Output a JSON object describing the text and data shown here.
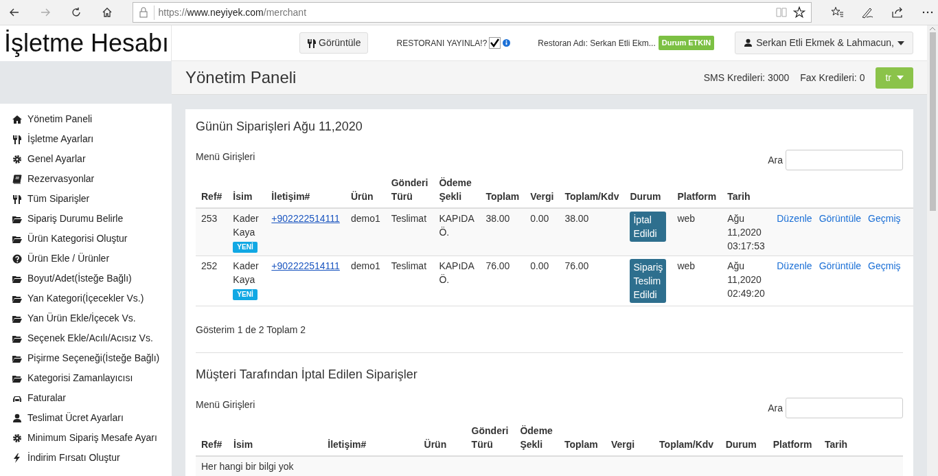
{
  "browser": {
    "url_scheme": "https://",
    "url_host": "www.neyiyek.com",
    "url_path": "/merchant"
  },
  "header": {
    "brand": "İşletme Hesabı",
    "view_button": "Görüntüle",
    "publish_label": "RESTORANI YAYINLA!?",
    "publish_checked": true,
    "restaurant_name": "Restoran Adı: Serkan Etli Ekm...",
    "status_badge": "Durum ETKIN",
    "user_menu": "Serkan Etli Ekmek & Lahmacun,"
  },
  "subheader": {
    "title": "Yönetim Paneli",
    "sms": "SMS Kredileri: 3000",
    "fax": "Fax Kredileri: 0",
    "language": "tr"
  },
  "sidebar": {
    "items": [
      {
        "label": "Yönetim Paneli"
      },
      {
        "label": "İşletme Ayarları"
      },
      {
        "label": "Genel Ayarlar"
      },
      {
        "label": "Rezervasyonlar"
      },
      {
        "label": "Tüm Siparişler"
      },
      {
        "label": "Sipariş Durumu Belirle"
      },
      {
        "label": "Ürün Kategorisi Oluştur"
      },
      {
        "label": "Ürün Ekle / Ürünler"
      },
      {
        "label": "Boyut/Adet(İsteğe Bağlı)"
      },
      {
        "label": "Yan Kategori(İçecekler Vs.)"
      },
      {
        "label": "Yan Ürün Ekle/İçecek Vs."
      },
      {
        "label": "Seçenek Ekle/Acılı/Acısız Vs."
      },
      {
        "label": "Pişirme Seçeneği(İsteğe Bağlı)"
      },
      {
        "label": "Kategorisi Zamanlayıcısı"
      },
      {
        "label": "Faturalar"
      },
      {
        "label": "Teslimat Ücret Ayarları"
      },
      {
        "label": "Minimum Sipariş Mesafe Ayarı"
      },
      {
        "label": "İndirim Fırsatı Oluştur"
      }
    ]
  },
  "sections": [
    {
      "title": "Günün Siparişleri Ağu 11,2020",
      "entries_label": "Menü Girişleri",
      "search_label": "Ara",
      "columns": [
        "Ref#",
        "İsim",
        "İletişim#",
        "Ürün",
        "Gönderi Türü",
        "Ödeme Şekli",
        "Toplam",
        "Vergi",
        "Toplam/Kdv",
        "Durum",
        "Platform",
        "Tarih"
      ],
      "rows": [
        {
          "ref": "253",
          "name": "Kader Kaya",
          "badge": "YENİ",
          "phone": "+902222514111",
          "product": "demo1",
          "delivery": "Teslimat",
          "payment": "KAPıDA Ö.",
          "total": "38.00",
          "tax": "0.00",
          "total_kdv": "38.00",
          "status": "İptal Edildi",
          "platform": "web",
          "date": "Ağu 11,2020 03:17:53",
          "actions": [
            "Düzenle",
            "Görüntüle",
            "Geçmiş"
          ]
        },
        {
          "ref": "252",
          "name": "Kader Kaya",
          "badge": "YENİ",
          "phone": "+902222514111",
          "product": "demo1",
          "delivery": "Teslimat",
          "payment": "KAPıDA Ö.",
          "total": "76.00",
          "tax": "0.00",
          "total_kdv": "76.00",
          "status": "Sipariş Teslim Edildi",
          "platform": "web",
          "date": "Ağu 11,2020 02:49:20",
          "actions": [
            "Düzenle",
            "Görüntüle",
            "Geçmiş"
          ]
        }
      ],
      "footer": "Gösterim 1 de 2 Toplam 2"
    },
    {
      "title": "Müşteri Tarafından İptal Edilen Siparişler",
      "entries_label": "Menü Girişleri",
      "search_label": "Ara",
      "columns": [
        "Ref#",
        "İsim",
        "İletişim#",
        "Ürün",
        "Gönderi Türü",
        "Ödeme Şekli",
        "Toplam",
        "Vergi",
        "Toplam/Kdv",
        "Durum",
        "Platform",
        "Tarih"
      ],
      "empty_text": "Her hangi bir bilgi yok"
    }
  ]
}
